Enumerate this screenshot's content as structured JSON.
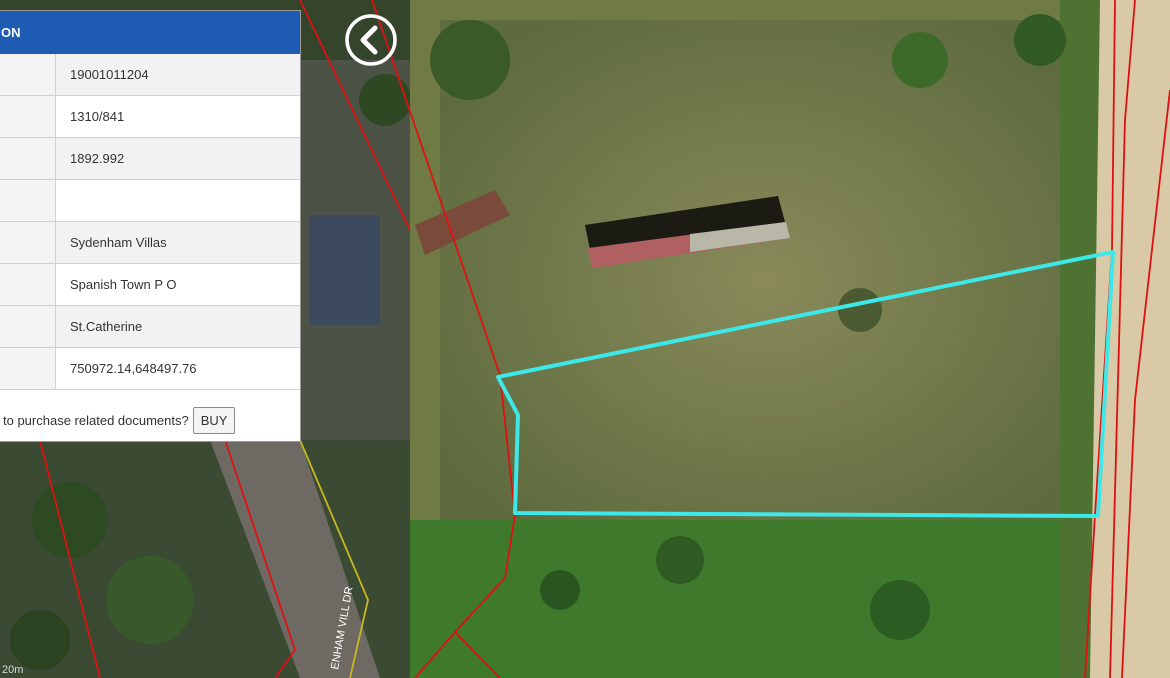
{
  "panel": {
    "header": "ON",
    "rows": [
      {
        "value": "19001011204"
      },
      {
        "value": "1310/841"
      },
      {
        "value": "1892.992"
      },
      {
        "value": ""
      },
      {
        "value": "Sydenham Villas"
      },
      {
        "value": "Spanish Town P O"
      },
      {
        "value": "St.Catherine"
      },
      {
        "value": "750972.14,648497.76"
      }
    ],
    "purchase_prompt": "to purchase related documents?",
    "buy_label": "BUY"
  },
  "map": {
    "road_label": "ENHAM VILL DR",
    "scale_label": "20m",
    "parcel_outline_color": "#3ee8e8",
    "boundary_color": "#e01010"
  },
  "icons": {
    "back": "chevron-left-circle-icon"
  }
}
